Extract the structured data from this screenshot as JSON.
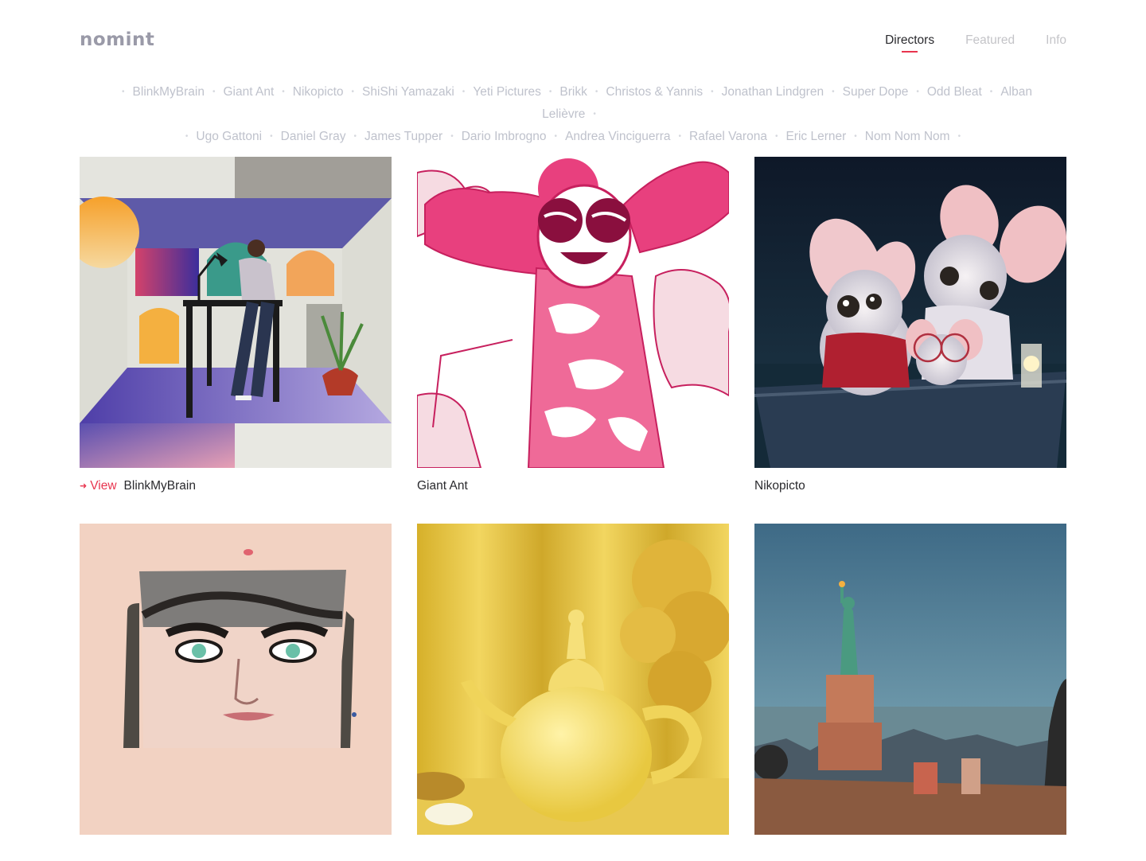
{
  "header": {
    "logo": "nomint",
    "nav": [
      {
        "label": "Directors",
        "active": true
      },
      {
        "label": "Featured",
        "active": false
      },
      {
        "label": "Info",
        "active": false
      }
    ]
  },
  "directors": [
    "BlinkMyBrain",
    "Giant Ant",
    "Nikopicto",
    "ShiShi Yamazaki",
    "Yeti Pictures",
    "Brikk",
    "Christos & Yannis",
    "Jonathan Lindgren",
    "Super Dope",
    "Odd Bleat",
    "Alban Lelièvre",
    "Ugo Gattoni",
    "Daniel Gray",
    "James Tupper",
    "Dario Imbrogno",
    "Andrea Vinciguerra",
    "Rafael Varona",
    "Eric Lerner",
    "Nom Nom Nom"
  ],
  "cards": [
    {
      "name": "BlinkMyBrain",
      "view_label": "View",
      "hover": true,
      "image": "office-desk-illustration"
    },
    {
      "name": "Giant Ant",
      "view_label": "",
      "hover": false,
      "image": "pink-character-illustration"
    },
    {
      "name": "Nikopicto",
      "view_label": "",
      "hover": false,
      "image": "mice-in-boat-render"
    },
    {
      "name": "",
      "view_label": "",
      "hover": false,
      "image": "watercolor-face-portrait"
    },
    {
      "name": "",
      "view_label": "",
      "hover": false,
      "image": "yellow-teapot-still-life"
    },
    {
      "name": "",
      "view_label": "",
      "hover": false,
      "image": "statue-of-liberty-scene"
    }
  ],
  "colors": {
    "accent": "#e8344e",
    "muted_text": "#bfc2cc",
    "logo": "#9a9aa8"
  }
}
